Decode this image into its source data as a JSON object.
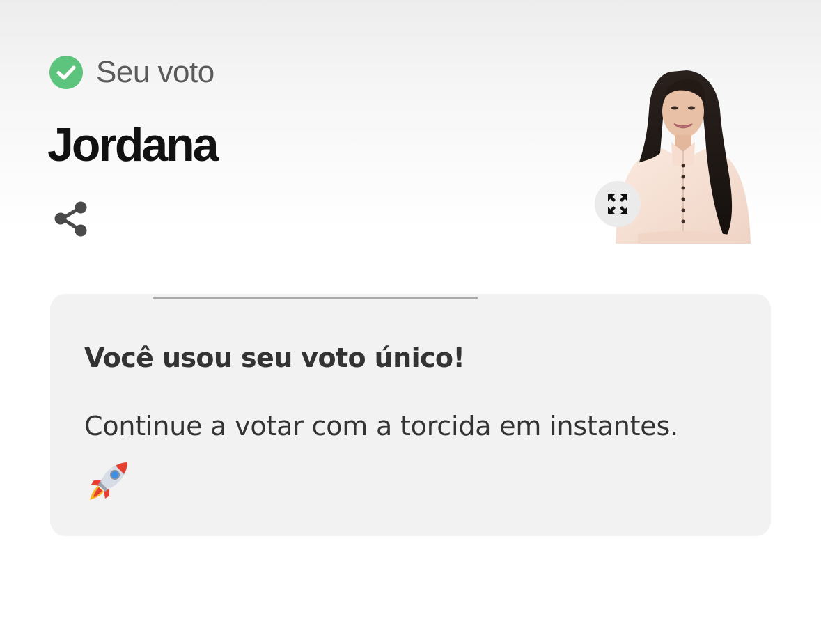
{
  "vote": {
    "status_label": "Seu voto",
    "candidate_name": "Jordana",
    "status_color": "#5cc47c"
  },
  "actions": {
    "share_icon": "share-icon",
    "expand_icon": "expand-arrows-icon"
  },
  "card": {
    "title": "Você usou seu voto único!",
    "message": "Continue a votar com a torcida em instantes.",
    "message_icon": "rocket-emoji"
  }
}
